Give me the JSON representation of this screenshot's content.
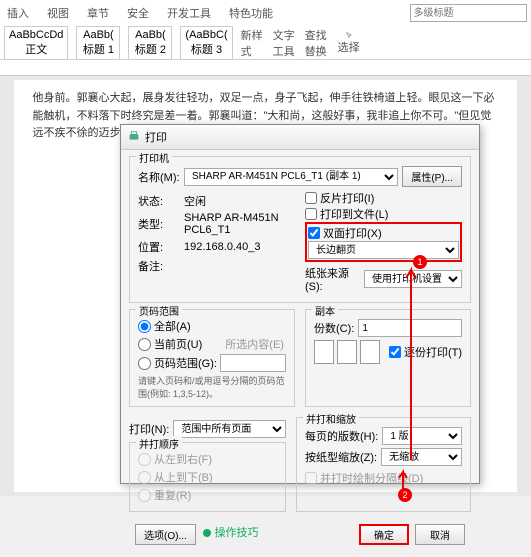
{
  "tabs": [
    "插入",
    "视图",
    "章节",
    "安全",
    "开发工具",
    "特色功能"
  ],
  "searchPlaceholder": "多级标题",
  "styles": [
    {
      "sample": "AaBbCcDd",
      "name": "正文"
    },
    {
      "sample": "AaBb(",
      "name": "标题 1"
    },
    {
      "sample": "AaBb(",
      "name": "标题 2"
    },
    {
      "sample": "(AaBbC(",
      "name": "标题 3"
    }
  ],
  "ribbonActions": [
    "新样式",
    "文字工具",
    "查找替换",
    "选择"
  ],
  "docText": "他身前。郭襄心大起，展身发往轻功，双足一点，身子飞起，伸手往铁椅道上轻。眼见这一下必能触机，不料落下时终究是差一着。郭襄叫道：\"大和尚，这般好事，我非追上你不可。\"但见觉远不疾不徐的迈步而行，铁链声当……",
  "dialog": {
    "title": "打印",
    "printer": {
      "groupTitle": "打印机",
      "nameLabel": "名称(M):",
      "nameValue": "SHARP AR-M451N PCL6_T1 (副本 1)",
      "propsBtn": "属性(P)...",
      "statusLabel": "状态:",
      "statusValue": "空闲",
      "typeLabel": "类型:",
      "typeValue": "SHARP AR-M451N PCL6_T1",
      "locationLabel": "位置:",
      "locationValue": "192.168.0.40_3",
      "commentLabel": "备注:",
      "reverseCheck": "反片打印(I)",
      "toFileCheck": "打印到文件(L)",
      "duplexCheck": "双面打印(X)",
      "longEdge": "长边翻页",
      "paperSourceLabel": "纸张来源(S):",
      "paperSourceValue": "使用打印机设置"
    },
    "range": {
      "groupTitle": "页码范围",
      "all": "全部(A)",
      "current": "当前页(U)",
      "selection": "所选内容(E)",
      "pages": "页码范围(G):",
      "hint": "请键入页码和/或用逗号分隔的页码范围(例如: 1,3,5-12)。"
    },
    "copies": {
      "groupTitle": "副本",
      "countLabel": "份数(C):",
      "countValue": "1",
      "collate": "逐份打印(T)"
    },
    "printWhat": {
      "printLabel": "打印(N):",
      "printValue": "范围中所有页面",
      "orderGroup": "并打顺序",
      "ltr": "从左到右(F)",
      "ttb": "从上到下(B)",
      "repeat": "重复(R)"
    },
    "zoom": {
      "groupTitle": "并打和缩放",
      "perSheetLabel": "每页的版数(H):",
      "perSheetValue": "1 版",
      "scaleLabel": "按纸型缩放(Z):",
      "scaleValue": "无缩放",
      "drawLines": "并打时绘制分隔线(D)"
    },
    "optionsBtn": "选项(O)...",
    "tipsLink": "操作技巧",
    "ok": "确定",
    "cancel": "取消"
  },
  "badges": {
    "one": "1",
    "two": "2"
  }
}
